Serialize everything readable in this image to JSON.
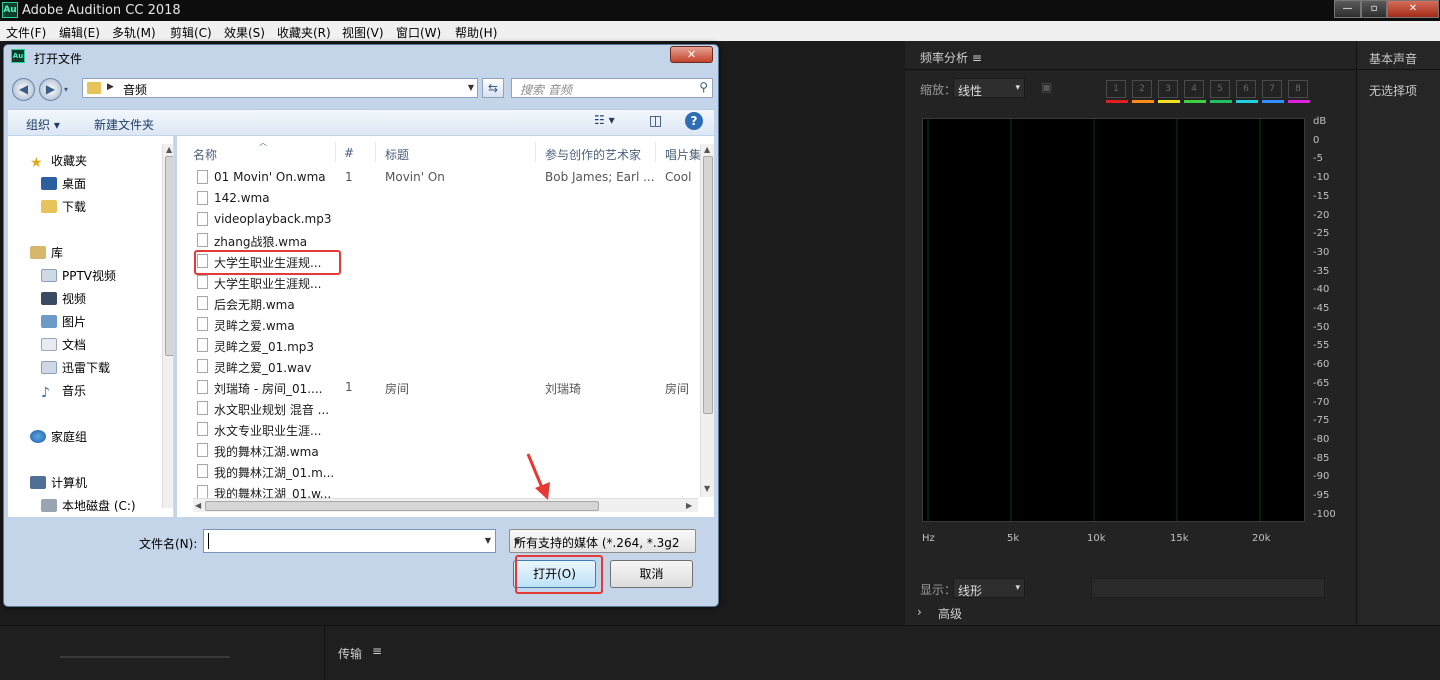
{
  "app": {
    "title": "Adobe Audition CC 2018",
    "logo": "Au",
    "window_buttons": [
      "—",
      "▫",
      "✕"
    ]
  },
  "menu": [
    "文件(F)",
    "编辑(E)",
    "多轨(M)",
    "剪辑(C)",
    "效果(S)",
    "收藏夹(R)",
    "视图(V)",
    "窗口(W)",
    "帮助(H)"
  ],
  "freq_panel": {
    "title": "频率分析",
    "zoom_label": "缩放：",
    "zoom_value": "线性",
    "channels": [
      "1",
      "2",
      "3",
      "4",
      "5",
      "6",
      "7",
      "8"
    ],
    "channel_colors": [
      "#e02020",
      "#ff8c1a",
      "#f0e020",
      "#40d040",
      "#20c060",
      "#20d0e0",
      "#3090ff",
      "#e020e0"
    ],
    "db_labels": [
      "dB",
      "0",
      "-5",
      "-10",
      "-15",
      "-20",
      "-25",
      "-30",
      "-35",
      "-40",
      "-45",
      "-50",
      "-55",
      "-60",
      "-65",
      "-70",
      "-75",
      "-80",
      "-85",
      "-90",
      "-95",
      "-100"
    ],
    "hz_labels": [
      "Hz",
      "5k",
      "10k",
      "15k",
      "20k"
    ],
    "display_label": "显示：",
    "display_value": "线形",
    "advanced_label": "高级"
  },
  "essential_sound": {
    "title": "基本声音",
    "no_selection": "无选择项"
  },
  "transport": {
    "title": "传输"
  },
  "dialog": {
    "title": "打开文件",
    "close": "✕",
    "path": "音频",
    "search_placeholder": "搜索 音频",
    "organize": "组织 ▾",
    "new_folder": "新建文件夹",
    "help": "?",
    "nav": {
      "favorites": "收藏夹",
      "desktop": "桌面",
      "downloads": "下载",
      "libraries": "库",
      "pptv": "PPTV视频",
      "videos": "视频",
      "pictures": "图片",
      "documents": "文档",
      "xunlei": "迅雷下载",
      "music": "音乐",
      "homegroup": "家庭组",
      "computer": "计算机",
      "local_disk": "本地磁盘 (C:)"
    },
    "columns": {
      "name": "名称",
      "num": "#",
      "title": "标题",
      "artist": "参与创作的艺术家",
      "album": "唱片集"
    },
    "files": [
      {
        "name": "01 Movin' On.wma",
        "num": "1",
        "title": "Movin' On",
        "artist": "Bob James; Earl ...",
        "album": "Cool"
      },
      {
        "name": "142.wma",
        "num": "",
        "title": "",
        "artist": "",
        "album": ""
      },
      {
        "name": "videoplayback.mp3",
        "num": "",
        "title": "",
        "artist": "",
        "album": ""
      },
      {
        "name": "zhang战狼.wma",
        "num": "",
        "title": "",
        "artist": "",
        "album": ""
      },
      {
        "name": "大学生职业生涯规...",
        "num": "",
        "title": "",
        "artist": "",
        "album": ""
      },
      {
        "name": "大学生职业生涯规...",
        "num": "",
        "title": "",
        "artist": "",
        "album": ""
      },
      {
        "name": "后会无期.wma",
        "num": "",
        "title": "",
        "artist": "",
        "album": ""
      },
      {
        "name": "灵眸之爱.wma",
        "num": "",
        "title": "",
        "artist": "",
        "album": ""
      },
      {
        "name": "灵眸之爱_01.mp3",
        "num": "",
        "title": "",
        "artist": "",
        "album": ""
      },
      {
        "name": "灵眸之爱_01.wav",
        "num": "",
        "title": "",
        "artist": "",
        "album": ""
      },
      {
        "name": "刘瑞琦 - 房间_01....",
        "num": "1",
        "title": "房间",
        "artist": "刘瑞琦",
        "album": "房间"
      },
      {
        "name": "水文职业规划 混音 ...",
        "num": "",
        "title": "",
        "artist": "",
        "album": ""
      },
      {
        "name": "水文专业职业生涯...",
        "num": "",
        "title": "",
        "artist": "",
        "album": ""
      },
      {
        "name": "我的舞林江湖.wma",
        "num": "",
        "title": "",
        "artist": "",
        "album": ""
      },
      {
        "name": "我的舞林江湖_01.m...",
        "num": "",
        "title": "",
        "artist": "",
        "album": ""
      },
      {
        "name": "我的舞林江湖_01.w...",
        "num": "",
        "title": "",
        "artist": "",
        "album": ""
      }
    ],
    "filename_label": "文件名(N):",
    "filename_value": "",
    "filter_value": "所有支持的媒体 (*.264, *.3g2,",
    "open_button": "打开(O)",
    "cancel_button": "取消"
  },
  "highlight_color": "#e53935"
}
